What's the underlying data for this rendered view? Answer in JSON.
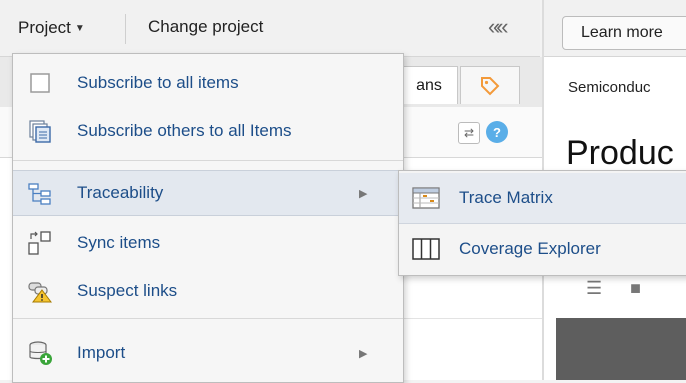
{
  "toolbar": {
    "project_label": "Project",
    "change_project_label": "Change project",
    "collapse_label": "«"
  },
  "left_pane": {
    "tabs": [
      {
        "label": "ans"
      },
      {
        "label": "",
        "icon": "tag-icon"
      }
    ],
    "help_label": "?"
  },
  "right_pane": {
    "learn_more_label": "Learn more",
    "project_text": "Semiconduc",
    "heading_text": "Produc"
  },
  "menu": {
    "items": [
      {
        "label": "Subscribe to all items",
        "icon": "checkbox-icon"
      },
      {
        "label": "Subscribe others to all Items",
        "icon": "subscribe-others-icon"
      },
      {
        "label": "Traceability",
        "icon": "traceability-icon",
        "has_submenu": true,
        "highlighted": true
      },
      {
        "label": "Sync items",
        "icon": "sync-items-icon"
      },
      {
        "label": "Suspect links",
        "icon": "suspect-links-icon"
      },
      {
        "label": "Import",
        "icon": "import-icon",
        "has_submenu": true
      }
    ]
  },
  "submenu": {
    "items": [
      {
        "label": "Trace Matrix",
        "icon": "trace-matrix-icon"
      },
      {
        "label": "Coverage Explorer",
        "icon": "coverage-explorer-icon"
      }
    ]
  },
  "colors": {
    "menu_text": "#1d4e89",
    "highlight": "#e3e8ef",
    "help_blue": "#5aaee8"
  }
}
